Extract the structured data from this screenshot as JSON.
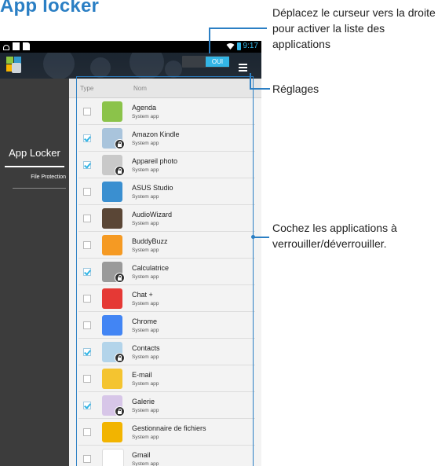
{
  "page": {
    "heading": "App locker"
  },
  "status_bar": {
    "time": "9:17"
  },
  "action_bar": {
    "toggle_label": "OUI"
  },
  "sidebar": {
    "items": [
      {
        "label": "App Locker"
      },
      {
        "label": "File Protection"
      }
    ]
  },
  "list": {
    "columns": {
      "type": "Type",
      "name": "Nom"
    },
    "rows": [
      {
        "name": "Agenda",
        "sub": "System app",
        "checked": false,
        "locked": false,
        "icon": "calendar-icon",
        "color": "#8bc34a"
      },
      {
        "name": "Amazon Kindle",
        "sub": "System app",
        "checked": true,
        "locked": true,
        "icon": "kindle-icon",
        "color": "#a9c4dc"
      },
      {
        "name": "Appareil photo",
        "sub": "System app",
        "checked": true,
        "locked": true,
        "icon": "camera-icon",
        "color": "#c9c9c9"
      },
      {
        "name": "ASUS Studio",
        "sub": "System app",
        "checked": false,
        "locked": false,
        "icon": "asus-studio-icon",
        "color": "#3a8fd0"
      },
      {
        "name": "AudioWizard",
        "sub": "System app",
        "checked": false,
        "locked": false,
        "icon": "audiowizard-icon",
        "color": "#5a4636"
      },
      {
        "name": "BuddyBuzz",
        "sub": "System app",
        "checked": false,
        "locked": false,
        "icon": "buddybuzz-icon",
        "color": "#f59a23"
      },
      {
        "name": "Calculatrice",
        "sub": "System app",
        "checked": true,
        "locked": true,
        "icon": "calculator-icon",
        "color": "#9a9a9a"
      },
      {
        "name": "Chat +",
        "sub": "System app",
        "checked": false,
        "locked": false,
        "icon": "chat-icon",
        "color": "#e53935"
      },
      {
        "name": "Chrome",
        "sub": "System app",
        "checked": false,
        "locked": false,
        "icon": "chrome-icon",
        "color": "#4285f4"
      },
      {
        "name": "Contacts",
        "sub": "System app",
        "checked": true,
        "locked": true,
        "icon": "contacts-icon",
        "color": "#b3d4ea"
      },
      {
        "name": "E-mail",
        "sub": "System app",
        "checked": false,
        "locked": false,
        "icon": "email-icon",
        "color": "#f4c430"
      },
      {
        "name": "Galerie",
        "sub": "System app",
        "checked": true,
        "locked": true,
        "icon": "gallery-icon",
        "color": "#d7c6e8"
      },
      {
        "name": "Gestionnaire de fichiers",
        "sub": "System app",
        "checked": false,
        "locked": false,
        "icon": "file-manager-icon",
        "color": "#f2b400"
      },
      {
        "name": "Gmail",
        "sub": "System app",
        "checked": false,
        "locked": false,
        "icon": "gmail-icon",
        "color": "#ffffff"
      }
    ]
  },
  "annotations": {
    "toggle_note": "Déplacez le curseur vers la droite pour activer la liste des applications",
    "settings_note": "Réglages",
    "checkbox_note": "Cochez les applications à verrouiller/déverrouiller."
  },
  "colors": {
    "accent": "#2b7fc4",
    "holo_blue": "#33b5e5"
  }
}
